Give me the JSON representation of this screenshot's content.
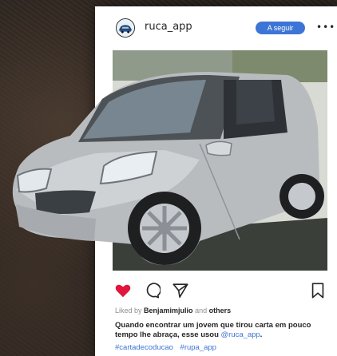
{
  "post": {
    "username": "ruca_app",
    "follow_label": "A seguir",
    "more_label": "•••",
    "likes": {
      "prefix": "Liked by",
      "user": "Benjamimjulio",
      "joiner": "and",
      "others": "others"
    },
    "caption": {
      "text": "Quando encontrar um jovem que tirou carta em pouco tempo lhe abraça, esse usou",
      "mention": "@ruca_app",
      "end": "."
    },
    "hashtags": [
      "#cartadecoducao",
      "#rupa_app"
    ]
  },
  "icons": {
    "avatar": "car-logo-icon",
    "like": "heart-filled-icon",
    "comment": "comment-bubble-icon",
    "share": "paper-plane-icon",
    "save": "bookmark-icon"
  },
  "colors": {
    "accent": "#3c75d6",
    "heart": "#e0163c",
    "text": "#262626",
    "muted": "#8e8e8e"
  }
}
